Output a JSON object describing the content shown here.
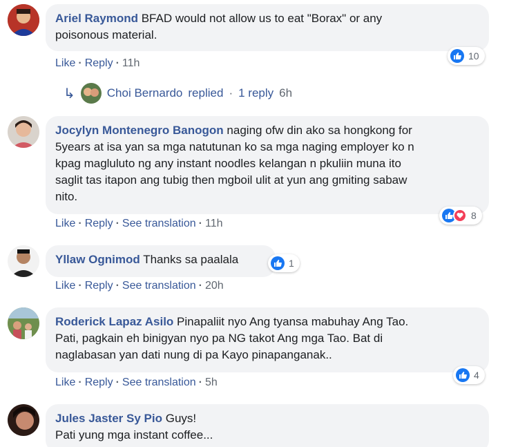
{
  "comments": [
    {
      "name": "Ariel Raymond",
      "text_lines": [
        "BFAD would not allow us to eat \"Borax\" or any",
        "poisonous material."
      ],
      "actions": {
        "like": "Like",
        "reply": "Reply",
        "time": "11h"
      },
      "reactions": {
        "count": "10",
        "types": [
          "like"
        ]
      }
    },
    {
      "name": "Jocylyn Montenegro Banogon",
      "text_lines": [
        "naging ofw din ako sa hongkong for",
        "5years at isa yan sa mga natutunan ko sa mga naging employer ko n",
        "kpag magluluto ng any instant noodles kelangan n pkuliin muna ito",
        "saglit tas itapon ang tubig then mgboil ulit at yun ang gmiting sabaw",
        "nito."
      ],
      "actions": {
        "like": "Like",
        "reply": "Reply",
        "translate": "See translation",
        "time": "11h"
      },
      "reactions": {
        "count": "8",
        "types": [
          "like",
          "love"
        ]
      }
    },
    {
      "name": "Yllaw Ognimod",
      "text_lines": [
        "Thanks sa paalala"
      ],
      "actions": {
        "like": "Like",
        "reply": "Reply",
        "translate": "See translation",
        "time": "20h"
      },
      "reactions": {
        "count": "1",
        "types": [
          "like"
        ]
      }
    },
    {
      "name": "Roderick Lapaz Asilo",
      "text_lines": [
        "Pinapaliit nyo Ang tyansa mabuhay Ang Tao.",
        "Pati, pagkain eh binigyan nyo pa NG takot Ang mga Tao. Bat di",
        "naglabasan yan dati nung di pa Kayo pinapanganak.."
      ],
      "actions": {
        "like": "Like",
        "reply": "Reply",
        "translate": "See translation",
        "time": "5h"
      },
      "reactions": {
        "count": "4",
        "types": [
          "like"
        ]
      }
    },
    {
      "name": "Jules Jaster Sy Pio",
      "text_lines": [
        "Guys!",
        "Pati yung mga instant coffee..."
      ]
    }
  ],
  "reply_summary": {
    "name": "Choi Bernardo",
    "replied": "replied",
    "count": "1 reply",
    "time": "6h"
  },
  "colors": {
    "link": "#385898",
    "bubble": "#f2f3f5",
    "like": "#1877f2",
    "love": "#f33e58"
  }
}
